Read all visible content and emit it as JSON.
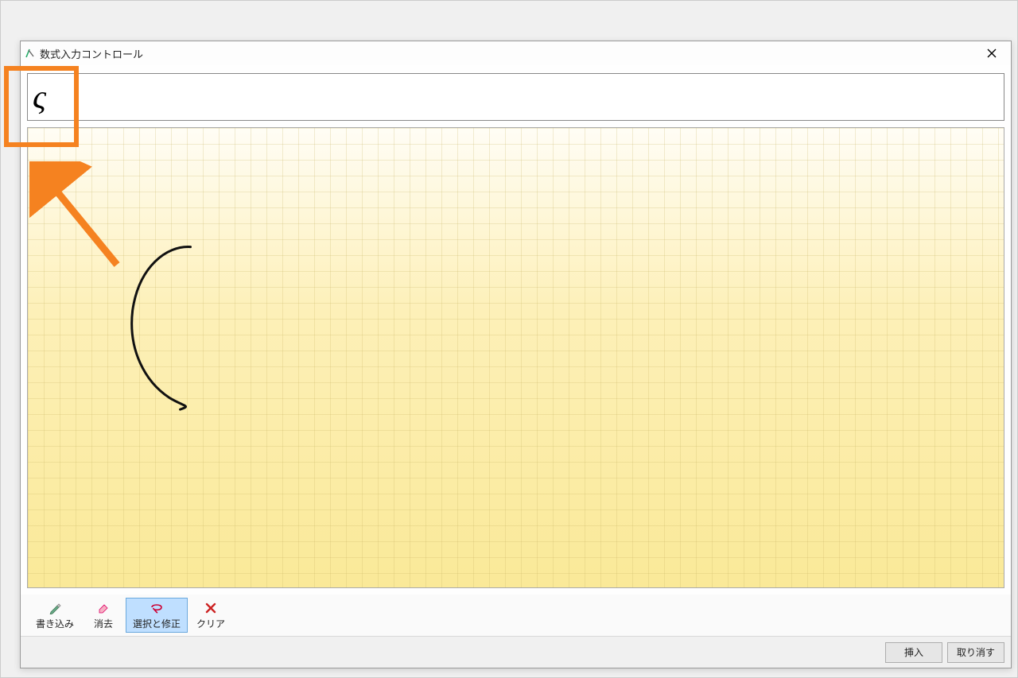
{
  "window": {
    "title": "数式入力コントロール"
  },
  "preview": {
    "recognized": "ς"
  },
  "toolbar": {
    "write": "書き込み",
    "erase": "消去",
    "select_correct": "選択と修正",
    "clear": "クリア"
  },
  "footer": {
    "insert": "挿入",
    "cancel": "取り消す"
  },
  "icons": {
    "pen": "pen-icon",
    "eraser": "eraser-icon",
    "lasso": "lasso-icon",
    "delete": "delete-icon",
    "close": "close-icon",
    "app": "math-input-icon"
  }
}
